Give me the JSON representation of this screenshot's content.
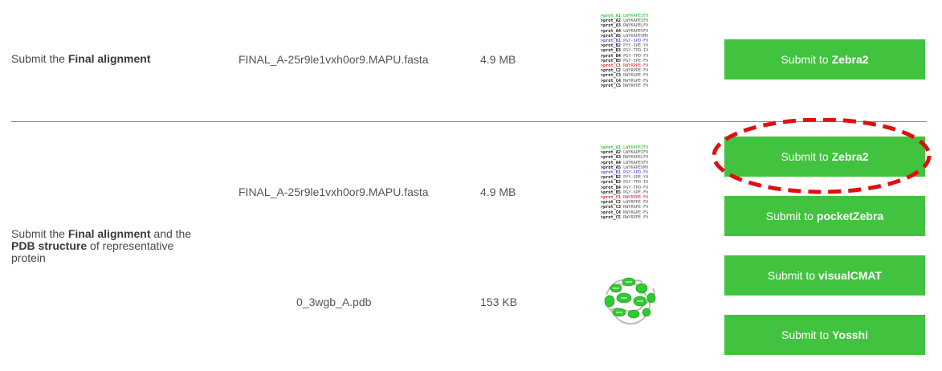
{
  "rows": [
    {
      "description_prefix": "Submit the",
      "description_bold": "Final alignment",
      "file_name": "FINAL_A-25r9le1vxh0or9.MAPU.fasta",
      "file_size": "4.9 MB",
      "buttons": [
        {
          "prefix": "Submit to",
          "target": "Zebra2"
        }
      ]
    },
    {
      "description_prefix": "Submit the",
      "description_bold": "Final alignment",
      "description_mid": "and the",
      "description_bold2": "PDB structure",
      "description_suffix": "of representative protein",
      "files": [
        {
          "file_name": "FINAL_A-25r9le1vxh0or9.MAPU.fasta",
          "file_size": "4.9 MB"
        },
        {
          "file_name": "0_3wgb_A.pdb",
          "file_size": "153 KB"
        }
      ],
      "buttons": [
        {
          "prefix": "Submit to",
          "target": "Zebra2"
        },
        {
          "prefix": "Submit to",
          "target": "pocketZebra"
        },
        {
          "prefix": "Submit to",
          "target": "visualCMAT"
        },
        {
          "prefix": "Submit to",
          "target": "Yosshi"
        }
      ]
    }
  ],
  "alignment_preview": [
    {
      "name": ">prot_A1",
      "seq": "LWYKAPEIFV",
      "color": "green"
    },
    {
      "name": ">prot_A2",
      "seq": "LWYKAPEIFV",
      "color": "black"
    },
    {
      "name": ">prot_A3",
      "seq": "RWYKAPELFV",
      "color": "black"
    },
    {
      "name": ">prot_A4",
      "seq": "LWYKAPEVFV",
      "color": "black"
    },
    {
      "name": ">prot_A5",
      "seq": "LWYKAPEVMV",
      "color": "black"
    },
    {
      "name": ">prot_B1",
      "seq": "PGY-SPD-FV",
      "color": "blue"
    },
    {
      "name": ">prot_B2",
      "seq": "PYY-SPE-YV",
      "color": "black"
    },
    {
      "name": ">prot_B3",
      "seq": "PGY-TPD-IV",
      "color": "black"
    },
    {
      "name": ">prot_B4",
      "seq": "PGY-TPD-FV",
      "color": "black"
    },
    {
      "name": ">prot_B5",
      "seq": "PGY-SPE-FV",
      "color": "black"
    },
    {
      "name": ">prot_C1",
      "seq": "RWYRPPE-FV",
      "color": "red"
    },
    {
      "name": ">prot_C2",
      "seq": "LWYRPPE-FV",
      "color": "black"
    },
    {
      "name": ">prot_C3",
      "seq": "RWYRGPE-FV",
      "color": "black"
    },
    {
      "name": ">prot_C4",
      "seq": "KWYRGPE-FG",
      "color": "black"
    },
    {
      "name": ">prot_C5",
      "seq": "RWYRPPE-FV",
      "color": "black"
    }
  ],
  "colors": {
    "button_bg": "#41c33f",
    "highlight_ellipse": "#e01010",
    "divider": "#888888"
  },
  "icons": [
    "sequence-alignment-thumbnail",
    "protein-structure-thumbnail"
  ]
}
